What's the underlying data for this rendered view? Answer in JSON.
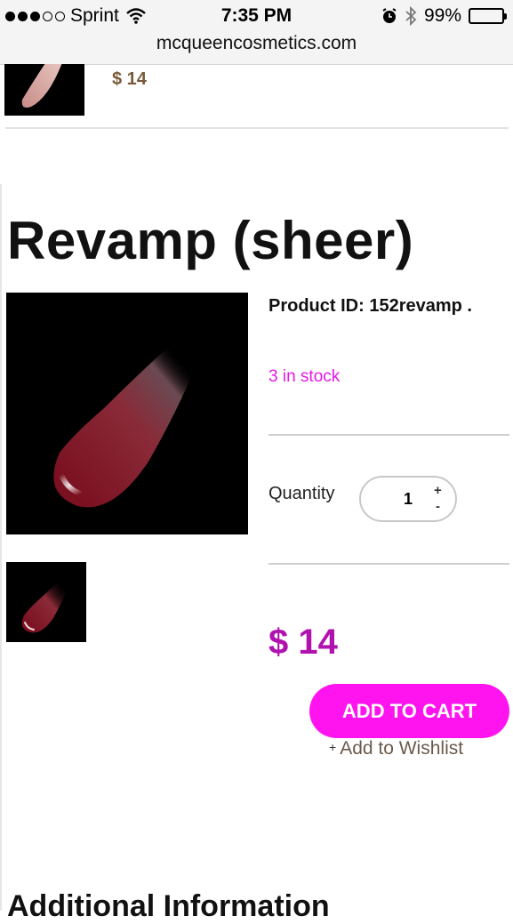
{
  "status_bar": {
    "carrier": "Sprint",
    "time": "7:35 PM",
    "battery": "99%",
    "url": "mcqueencosmetics.com"
  },
  "previous_item": {
    "price": "$ 14"
  },
  "product": {
    "title": "Revamp (sheer)",
    "product_id": "Product ID: 152revamp .",
    "stock": "3 in stock",
    "quantity_label": "Quantity",
    "quantity_value": "1",
    "qty_plus": "+",
    "qty_minus": "-",
    "price": "$ 14",
    "add_to_cart": "ADD TO CART",
    "wishlist_plus": "+",
    "wishlist": "Add to Wishlist"
  },
  "additional_info_heading": "Additional Information",
  "colors": {
    "accent": "#ff14f0",
    "price": "#b012b0",
    "stock": "#e61ae6"
  }
}
